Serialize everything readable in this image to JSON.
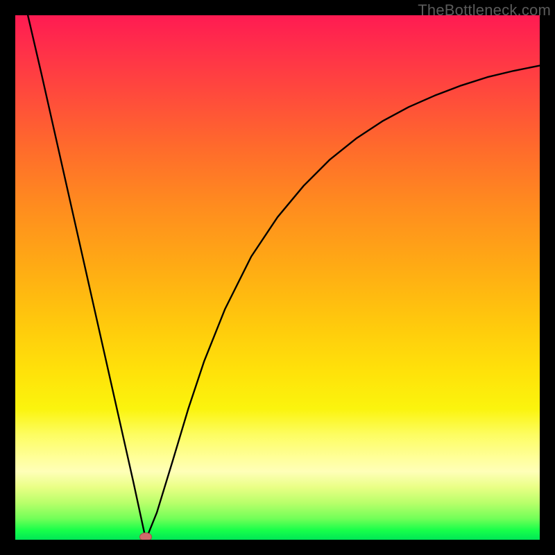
{
  "watermark": "TheBottleneck.com",
  "chart_data": {
    "type": "line",
    "title": "",
    "xlabel": "",
    "ylabel": "",
    "xlim": [
      0,
      1
    ],
    "ylim": [
      0,
      1
    ],
    "annotations": [
      {
        "type": "marker",
        "x": 0.249,
        "y": 0.005,
        "shape": "ellipse",
        "color": "#d06a6c"
      }
    ],
    "series": [
      {
        "name": "curve",
        "x": [
          0.024,
          0.05,
          0.1,
          0.15,
          0.2,
          0.225,
          0.249,
          0.27,
          0.3,
          0.33,
          0.36,
          0.4,
          0.45,
          0.5,
          0.55,
          0.6,
          0.65,
          0.7,
          0.75,
          0.8,
          0.85,
          0.9,
          0.95,
          1.0
        ],
        "y": [
          1.0,
          0.888,
          0.666,
          0.444,
          0.222,
          0.111,
          0.0,
          0.052,
          0.15,
          0.25,
          0.34,
          0.44,
          0.54,
          0.615,
          0.675,
          0.725,
          0.765,
          0.798,
          0.825,
          0.847,
          0.866,
          0.882,
          0.894,
          0.904
        ]
      }
    ]
  }
}
